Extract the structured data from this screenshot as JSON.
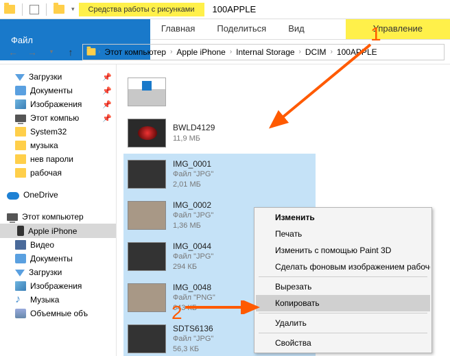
{
  "title_tab": "Средства работы с рисунками",
  "window_title": "100APPLE",
  "ribbon": {
    "file": "Файл",
    "home": "Главная",
    "share": "Поделиться",
    "view": "Вид",
    "manage": "Управление"
  },
  "breadcrumbs": [
    "Этот компьютер",
    "Apple iPhone",
    "Internal Storage",
    "DCIM",
    "100APPLE"
  ],
  "sidebar": {
    "downloads": "Загрузки",
    "documents": "Документы",
    "images": "Изображения",
    "this_pc_short": "Этот компью",
    "system32": "System32",
    "music": "музыка",
    "no_passwords": "нев пароли",
    "work": "рабочая",
    "onedrive": "OneDrive",
    "this_pc": "Этот компьютер",
    "apple_iphone": "Apple iPhone",
    "video": "Видео",
    "documents2": "Документы",
    "downloads2": "Загрузки",
    "images2": "Изображения",
    "music2": "Музыка",
    "volumes": "Объемные объ"
  },
  "files": [
    {
      "name": "",
      "meta1": "",
      "meta2": "",
      "thumb": "drive",
      "sel": false
    },
    {
      "name": "BWLD4129",
      "meta1": "11,9 МБ",
      "meta2": "",
      "thumb": "vid",
      "sel": false
    },
    {
      "name": "IMG_0001",
      "meta1": "Файл \"JPG\"",
      "meta2": "2,01 МБ",
      "thumb": "dark",
      "sel": true
    },
    {
      "name": "IMG_0002",
      "meta1": "Файл \"JPG\"",
      "meta2": "1,36 МБ",
      "thumb": "std",
      "sel": true
    },
    {
      "name": "IMG_0044",
      "meta1": "Файл \"JPG\"",
      "meta2": "294 КБ",
      "thumb": "dark",
      "sel": true
    },
    {
      "name": "IMG_0048",
      "meta1": "Файл \"PNG\"",
      "meta2": "643 КБ",
      "thumb": "std",
      "sel": true
    },
    {
      "name": "SDTS6136",
      "meta1": "Файл \"JPG\"",
      "meta2": "56,3 КБ",
      "thumb": "dark",
      "sel": true
    }
  ],
  "context_menu": {
    "edit": "Изменить",
    "print": "Печать",
    "paint3d": "Изменить с помощью Paint 3D",
    "wallpaper": "Сделать фоновым изображением рабочего стола",
    "cut": "Вырезать",
    "copy": "Копировать",
    "delete": "Удалить",
    "properties": "Свойства"
  },
  "annotations": {
    "one": "1",
    "two": "2"
  }
}
